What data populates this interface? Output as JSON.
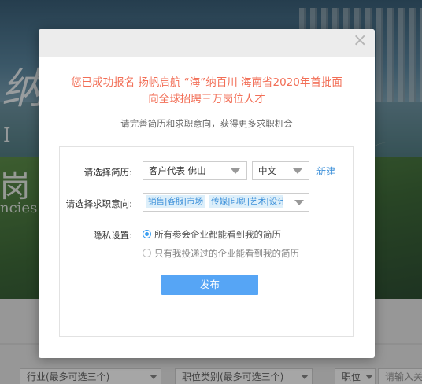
{
  "background": {
    "banner_words": [
      "纳",
      "I N",
      "岗",
      "ncies"
    ],
    "filters": [
      "行业(最多可选三个)",
      "职位类别(最多可选三个)",
      "职位",
      "请输入关"
    ]
  },
  "modal": {
    "title_line1": "您已成功报名 扬帆启航 “海”纳百川 海南省2020年首批面",
    "title_line2": "向全球招聘三万岗位人才",
    "subtitle": "请完善简历和求职意向，获得更多求职机会",
    "close": "×",
    "resume_label": "请选择简历:",
    "resume_value": "客户代表 佛山",
    "language_value": "中文",
    "new_link": "新建",
    "intent_label": "请选择求职意向:",
    "intent_tags": [
      "销售|客服|市场",
      "传媒|印刷|艺术|设计"
    ],
    "privacy_label": "隐私设置:",
    "privacy_options": [
      "所有参会企业都能看到我的简历",
      "只有我投递过的企业能看到我的简历"
    ],
    "submit": "发布"
  },
  "colors": {
    "title": "#f26f57",
    "accent": "#56a5f5",
    "link": "#3b8fd9"
  }
}
